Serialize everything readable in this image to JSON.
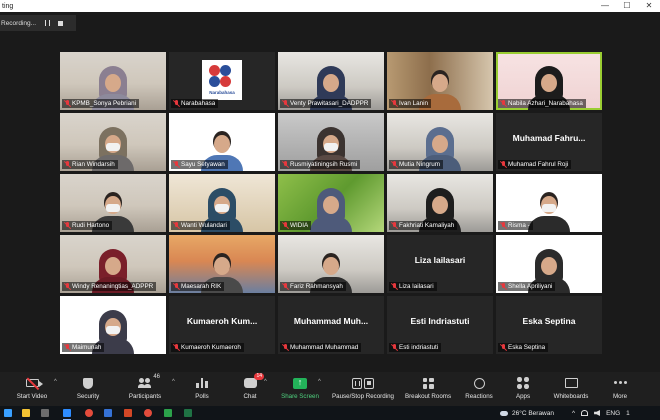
{
  "window": {
    "title": "ting",
    "minimize": "—",
    "maximize": "☐",
    "close": "✕"
  },
  "recording": {
    "label": "Recording..."
  },
  "tiles": [
    {
      "name": "KPMB_Sonya Pebriani",
      "kind": "video",
      "bg": "bg-room",
      "hijab": "#8b7f91",
      "body": "#8d8a9c"
    },
    {
      "name": "Narabahasa",
      "kind": "logo",
      "logo_text": "Narabahasa"
    },
    {
      "name": "Venty Prawitasari_DADPPR",
      "kind": "video",
      "bg": "bg-office",
      "hijab": "#2f3a58",
      "body": "#2f3a58"
    },
    {
      "name": "Ivan Lanin",
      "kind": "video",
      "bg": "bg-shelf",
      "hijab": "",
      "body": "#a86b3c"
    },
    {
      "name": "Nabila Azhari_Narabahasa",
      "kind": "video",
      "bg": "bg-pink",
      "hijab": "#1c1c1c",
      "body": "#1c1c1c",
      "active": true
    },
    {
      "name": "Rian Windarsih",
      "kind": "video",
      "bg": "bg-room",
      "hijab": "#7c7160",
      "body": "#6d6a6a",
      "mask": true
    },
    {
      "name": "Sayu Setyawan",
      "kind": "video",
      "bg": "bg-white",
      "hijab": "",
      "body": "#4f77b5"
    },
    {
      "name": "Rusmiyatiningsih Rusmi",
      "kind": "video",
      "bg": "bg-dim",
      "hijab": "#3b3330",
      "body": "#5a4a44",
      "mask": true
    },
    {
      "name": "Mutia Ningrum",
      "kind": "video",
      "bg": "bg-office",
      "hijab": "#5b6e8f",
      "body": "#4c5d7a"
    },
    {
      "name": "Muhamad Fahrul Roji",
      "kind": "name",
      "big": "Muhamad  Fahru..."
    },
    {
      "name": "Rudi Hartono",
      "kind": "video",
      "bg": "bg-room",
      "hijab": "",
      "body": "#3a3a3a",
      "mask": true
    },
    {
      "name": "Wanti Wulandari",
      "kind": "video",
      "bg": "bg-warm",
      "hijab": "#2c4d66",
      "body": "#2c4d66",
      "mask": true
    },
    {
      "name": "WIDIA",
      "kind": "video",
      "bg": "bg-green",
      "hijab": "#4e5a7a",
      "body": "#4e5a7a"
    },
    {
      "name": "Fakhriati Kamaliyah",
      "kind": "video",
      "bg": "bg-office",
      "hijab": "#1e1e1e",
      "body": "#1e1e1e"
    },
    {
      "name": "Risma -",
      "kind": "video",
      "bg": "bg-white",
      "hijab": "",
      "body": "#2b2b2b",
      "mask": true
    },
    {
      "name": "Windy Renaningtias_ADPPR",
      "kind": "video",
      "bg": "bg-room",
      "hijab": "#7a1f2a",
      "body": "#6c1b25"
    },
    {
      "name": "Maesarah RIK",
      "kind": "video",
      "bg": "bg-sunset",
      "hijab": "",
      "body": "#4a4a4a"
    },
    {
      "name": "Fariz Rahmansyah",
      "kind": "video",
      "bg": "bg-office",
      "hijab": "",
      "body": "#2e2e2e"
    },
    {
      "name": "Liza lailasari",
      "kind": "name",
      "big": "Liza lailasari"
    },
    {
      "name": "Shella Apriliyani",
      "kind": "video",
      "bg": "bg-white",
      "hijab": "#2b2b2b",
      "body": "#2b2b2b"
    },
    {
      "name": "Maimunah",
      "kind": "video",
      "bg": "bg-white",
      "hijab": "#3c3c4a",
      "body": "#3c3c4a",
      "mask": true
    },
    {
      "name": "Kumaeroh Kumaeroh",
      "kind": "name",
      "big": "Kumaeroh  Kum..."
    },
    {
      "name": "Muhammad Muhammad",
      "kind": "name",
      "big": "Muhammad  Muh..."
    },
    {
      "name": "Esti indriastuti",
      "kind": "name",
      "big": "Esti Indriastuti"
    },
    {
      "name": "Eska Septina",
      "kind": "name",
      "big": "Eska Septina"
    }
  ],
  "toolbar": {
    "start_video": "Start Video",
    "security": "Security",
    "participants": "Participants",
    "participants_count": "46",
    "polls": "Polls",
    "chat": "Chat",
    "chat_badge": "14",
    "share_screen": "Share Screen",
    "pause_stop": "Pause/Stop Recording",
    "breakout": "Breakout Rooms",
    "reactions": "Reactions",
    "apps": "Apps",
    "whiteboards": "Whiteboards",
    "more": "More",
    "caret": "^"
  },
  "taskbar": {
    "weather": "26°C  Berawan",
    "lang": "ENG",
    "time": "1"
  },
  "colors": {
    "share_green": "#23b35a",
    "alert_red": "#e8383d",
    "active_speaker": "#9acd32"
  }
}
